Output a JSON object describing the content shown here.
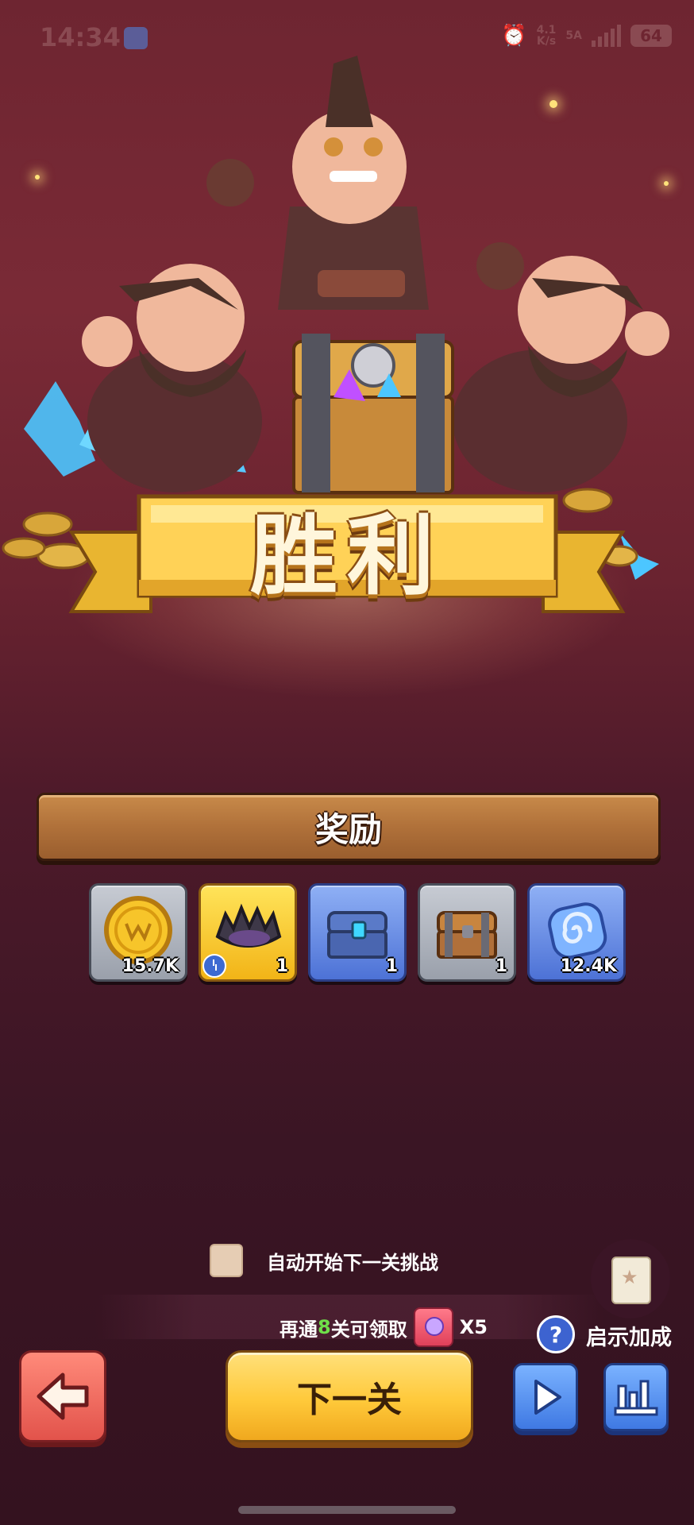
{
  "status_bar": {
    "time": "14:34",
    "speed_value": "4.1",
    "speed_unit": "K/s",
    "network": "5A",
    "battery": "64",
    "icons": [
      "app-notification-icon",
      "alarm-icon",
      "signal-icon",
      "battery-icon"
    ]
  },
  "banner": {
    "title": "胜利"
  },
  "rewards": {
    "title": "奖励",
    "items": [
      {
        "name": "gold-coin",
        "count": "15.7K",
        "style": "gray"
      },
      {
        "name": "spiked-crown",
        "count": "1",
        "style": "gold"
      },
      {
        "name": "blue-chest",
        "count": "1",
        "style": "blue"
      },
      {
        "name": "wooden-chest",
        "count": "1",
        "style": "gray"
      },
      {
        "name": "spiral-gem",
        "count": "12.4K",
        "style": "blue"
      }
    ]
  },
  "auto_next": {
    "label": "自动开始下一关挑战",
    "checked": false
  },
  "progress": {
    "prefix": "再通",
    "levels": "8",
    "suffix": "关可领取",
    "multiplier": "X5"
  },
  "boost": {
    "label": "启示加成",
    "help": "?"
  },
  "buttons": {
    "next_level": "下一关"
  },
  "colors": {
    "accent_gold": "#ffc93a",
    "bg_top": "#6e2531",
    "bg_bottom": "#34121f",
    "progress_highlight": "#6fe04a"
  }
}
